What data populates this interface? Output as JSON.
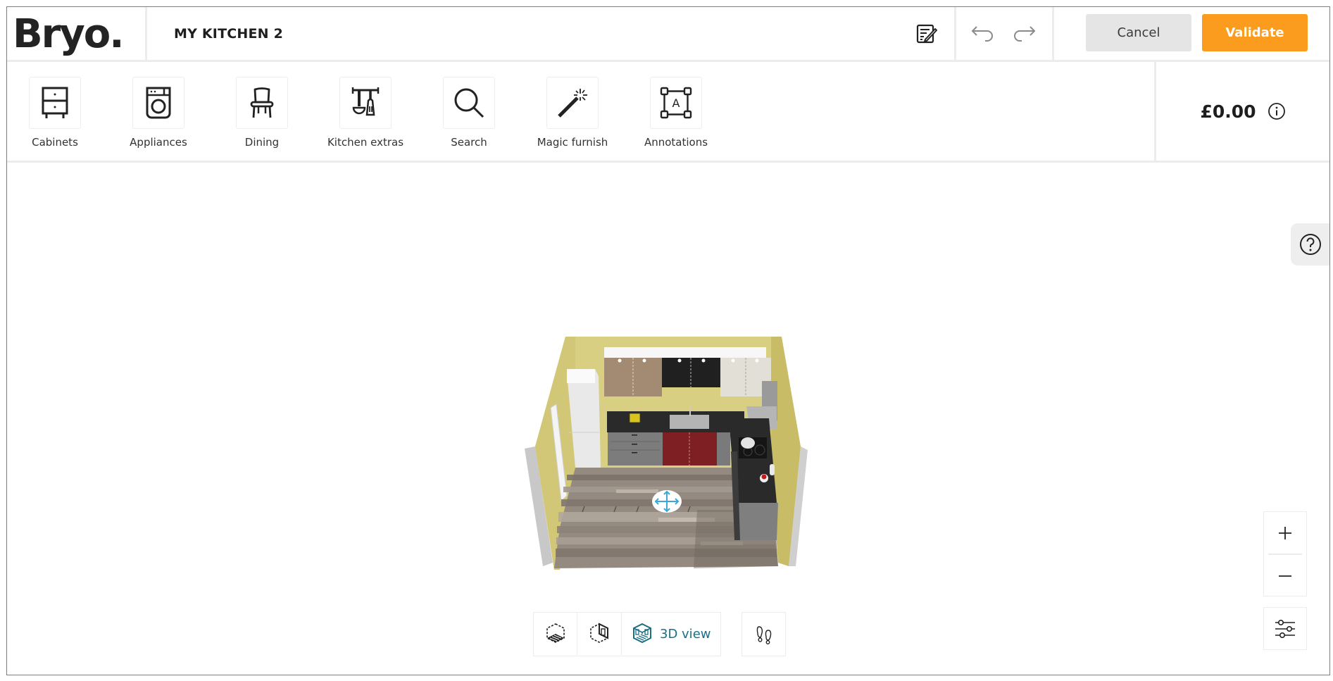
{
  "header": {
    "logo": "Bryo.",
    "project_title": "MY KITCHEN 2",
    "notes_icon": "notes-edit-icon",
    "undo_icon": "undo-arrow-icon",
    "redo_icon": "redo-arrow-icon",
    "cancel_label": "Cancel",
    "validate_label": "Validate"
  },
  "toolbar": {
    "items": [
      {
        "label": "Cabinets",
        "icon": "cabinet-icon"
      },
      {
        "label": "Appliances",
        "icon": "washing-machine-icon"
      },
      {
        "label": "Dining",
        "icon": "chair-icon"
      },
      {
        "label": "Kitchen extras",
        "icon": "utensils-rack-icon"
      },
      {
        "label": "Search",
        "icon": "search-icon"
      },
      {
        "label": "Magic furnish",
        "icon": "magic-wand-icon"
      },
      {
        "label": "Annotations",
        "icon": "annotation-icon"
      }
    ],
    "price": "£0.00",
    "price_info_icon": "info-icon"
  },
  "canvas": {
    "help_icon": "help-icon",
    "scene_description": "3D kitchen room view",
    "move_handle_icon": "move-arrows-icon",
    "view_modes": [
      {
        "label": "",
        "icon": "floor-plan-2d-icon",
        "active": false
      },
      {
        "label": "",
        "icon": "wall-elevation-icon",
        "active": false
      },
      {
        "label": "3D view",
        "icon": "3d-view-icon",
        "active": true
      }
    ],
    "walk_icon": "footsteps-icon",
    "zoom_in_label": "+",
    "zoom_out_label": "−",
    "settings_icon": "sliders-icon"
  },
  "colors": {
    "accent_orange": "#fb9c1e",
    "active_teal": "#1a6f85",
    "move_handle_blue": "#3aa8d8"
  }
}
